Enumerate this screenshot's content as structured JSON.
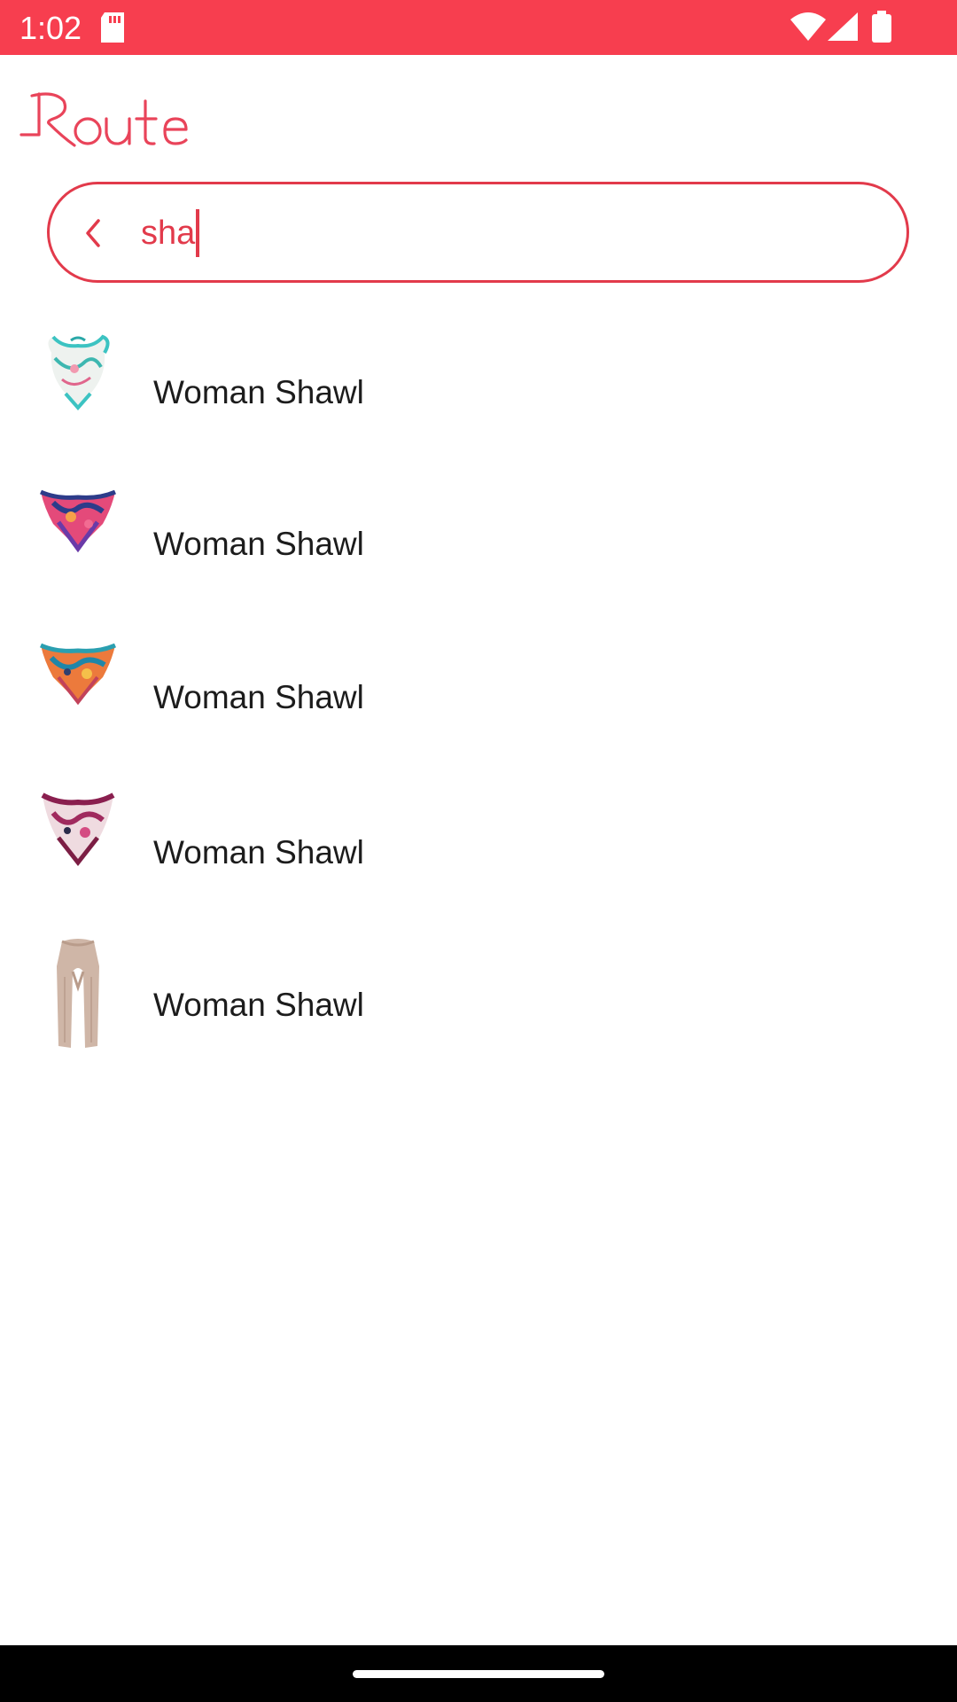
{
  "status_bar": {
    "time": "1:02",
    "icons": [
      "sd-card-icon",
      "wifi-icon",
      "signal-icon",
      "battery-icon"
    ],
    "background": "#f73e4f"
  },
  "app": {
    "logo_text": "Route",
    "accent_color": "#e23a4b"
  },
  "search": {
    "value": "sha",
    "back_icon": "chevron-left-icon"
  },
  "results": [
    {
      "label": "Woman Shawl",
      "image": "silk-scarf-white-teal"
    },
    {
      "label": "Woman Shawl",
      "image": "silk-scarf-pink-navy"
    },
    {
      "label": "Woman Shawl",
      "image": "silk-scarf-orange-teal"
    },
    {
      "label": "Woman Shawl",
      "image": "silk-scarf-burgundy-cream"
    },
    {
      "label": "Woman Shawl",
      "image": "knit-scarf-beige"
    }
  ]
}
